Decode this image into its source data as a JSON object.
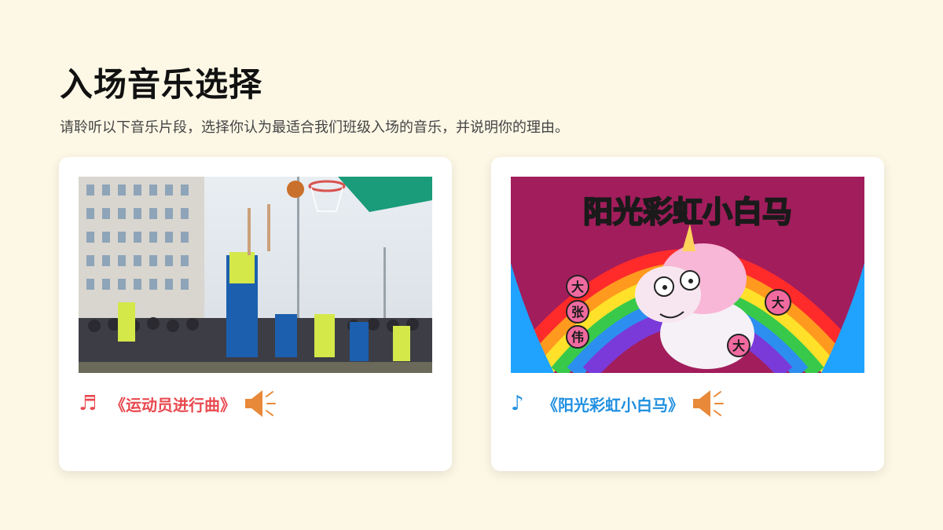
{
  "page": {
    "title": "入场音乐选择",
    "subtitle": "请聆听以下音乐片段，选择你认为最适合我们班级入场的音乐，并说明你的理由。"
  },
  "cards": [
    {
      "note_icon": "♬",
      "song_title": "《运动员进行曲》",
      "accent": "#e8494f",
      "image": "basketball-game-photo",
      "speaker_icon": "speaker-icon"
    },
    {
      "note_icon": "♪",
      "song_title": "《阳光彩虹小白马》",
      "accent": "#1f8fe0",
      "image": "rainbow-unicorn-illustration",
      "image_title": "阳光彩虹小白马",
      "image_badges": [
        "大",
        "张",
        "伟",
        "大",
        "大"
      ],
      "speaker_icon": "speaker-icon"
    }
  ],
  "colors": {
    "background": "#fdf8e6",
    "speaker": "#e8893a"
  }
}
